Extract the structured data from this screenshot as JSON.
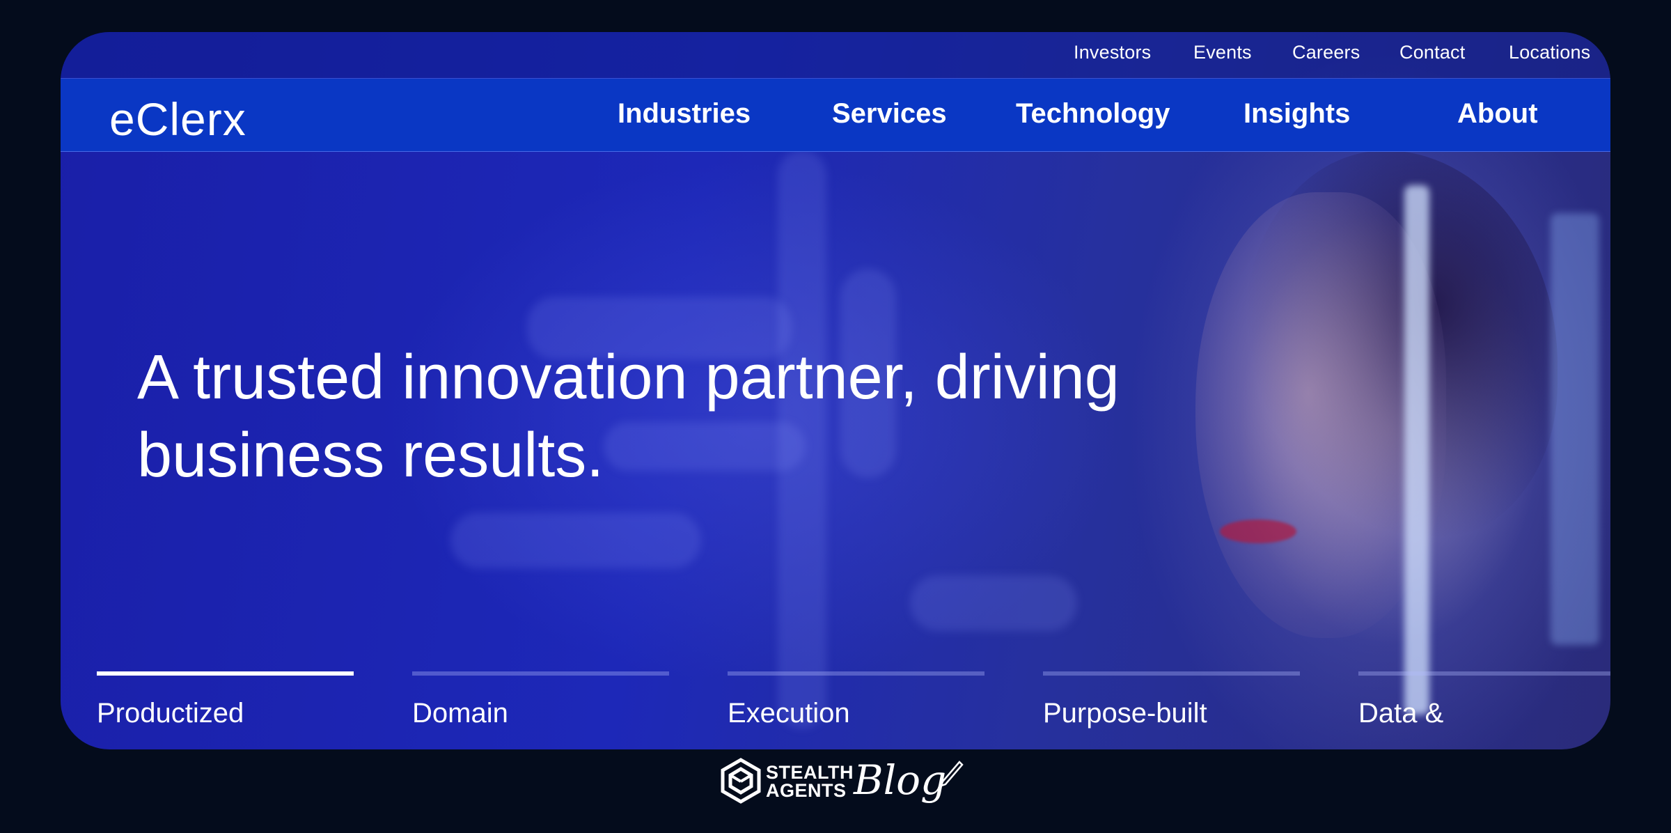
{
  "top_links": [
    "Investors",
    "Events",
    "Careers",
    "Contact",
    "Locations"
  ],
  "logo": "eClerx",
  "nav": [
    "Industries",
    "Services",
    "Technology",
    "Insights",
    "About"
  ],
  "hero": {
    "headline_line1": "A trusted innovation partner, driving",
    "headline_line2": "business results."
  },
  "tabs": [
    {
      "label": "Productized",
      "active": true
    },
    {
      "label": "Domain",
      "active": false
    },
    {
      "label": "Execution",
      "active": false
    },
    {
      "label": "Purpose-built",
      "active": false
    },
    {
      "label": "Data &",
      "active": false
    }
  ],
  "watermark": {
    "line1": "STEALTH",
    "line2": "AGENTS",
    "script": "Blog"
  },
  "colors": {
    "page_bg": "#040c1c",
    "nav_bg": "#0a37c4",
    "hero_accent": "#1d28b8",
    "text": "#ffffff"
  }
}
